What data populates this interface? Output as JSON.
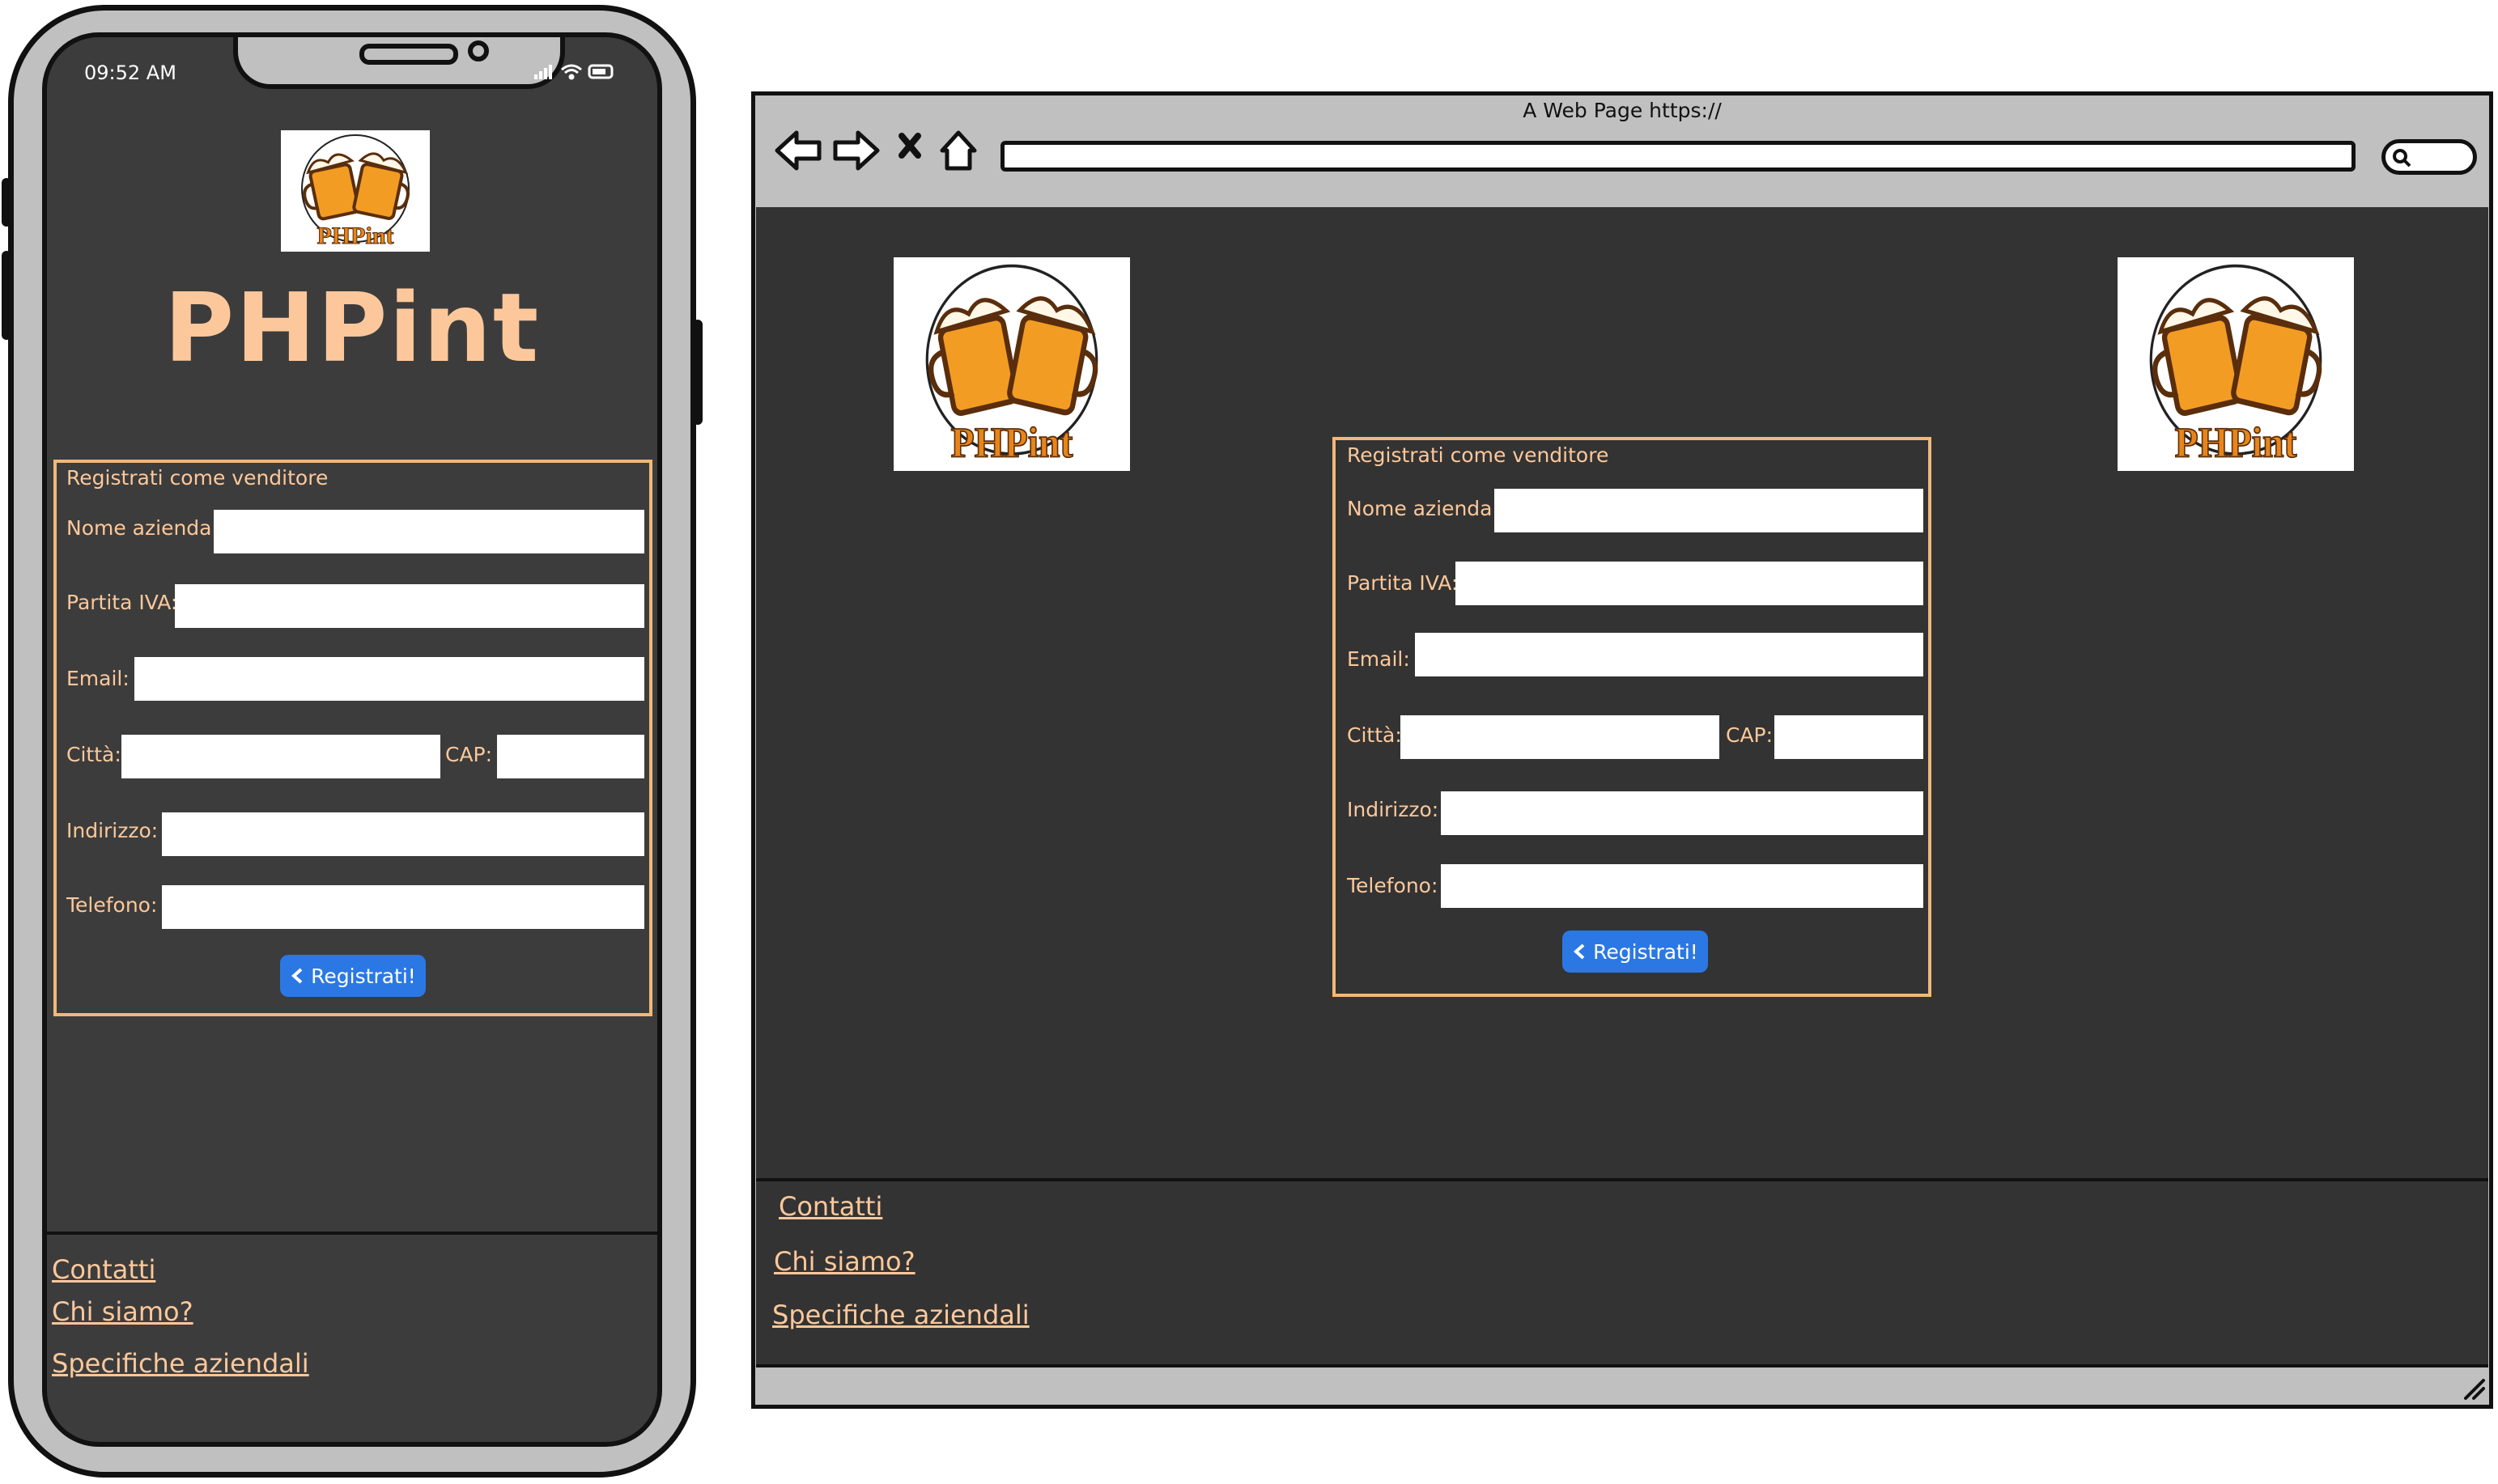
{
  "phone": {
    "status_time": "09:52 AM",
    "title": "PHPint",
    "form": {
      "legend": "Registrati come venditore",
      "fields": {
        "nome_azienda": "Nome azienda:",
        "partita_iva": "Partita IVA:",
        "email": "Email:",
        "citta": "Città:",
        "cap": "CAP:",
        "indirizzo": "Indirizzo:",
        "telefono": "Telefono:"
      },
      "submit_label": "Registrati!"
    },
    "footer_links": [
      "Contatti",
      "Chi siamo?",
      "Specifiche aziendali"
    ]
  },
  "browser": {
    "window_title": "A Web Page https://",
    "form": {
      "legend": "Registrati come venditore",
      "fields": {
        "nome_azienda": "Nome azienda:",
        "partita_iva": "Partita IVA:",
        "email": "Email:",
        "citta": "Città:",
        "cap": "CAP:",
        "indirizzo": "Indirizzo:",
        "telefono": "Telefono:"
      },
      "submit_label": "Registrati!"
    },
    "footer_links": [
      "Contatti",
      "Chi siamo?",
      "Specifiche aziendali"
    ]
  },
  "logo": {
    "text": "PHPint"
  },
  "colors": {
    "accent": "#fcc89b",
    "button": "#2b78e4",
    "page_bg": "#333333",
    "phone_bg": "#3c3c3c",
    "frame": "#c0c0c0"
  },
  "icons": [
    "back-arrow-icon",
    "forward-arrow-icon",
    "close-icon",
    "home-icon",
    "search-icon",
    "chevron-left-icon",
    "signal-icon",
    "wifi-icon",
    "battery-icon",
    "resize-grip-icon",
    "beer-mugs-logo"
  ]
}
